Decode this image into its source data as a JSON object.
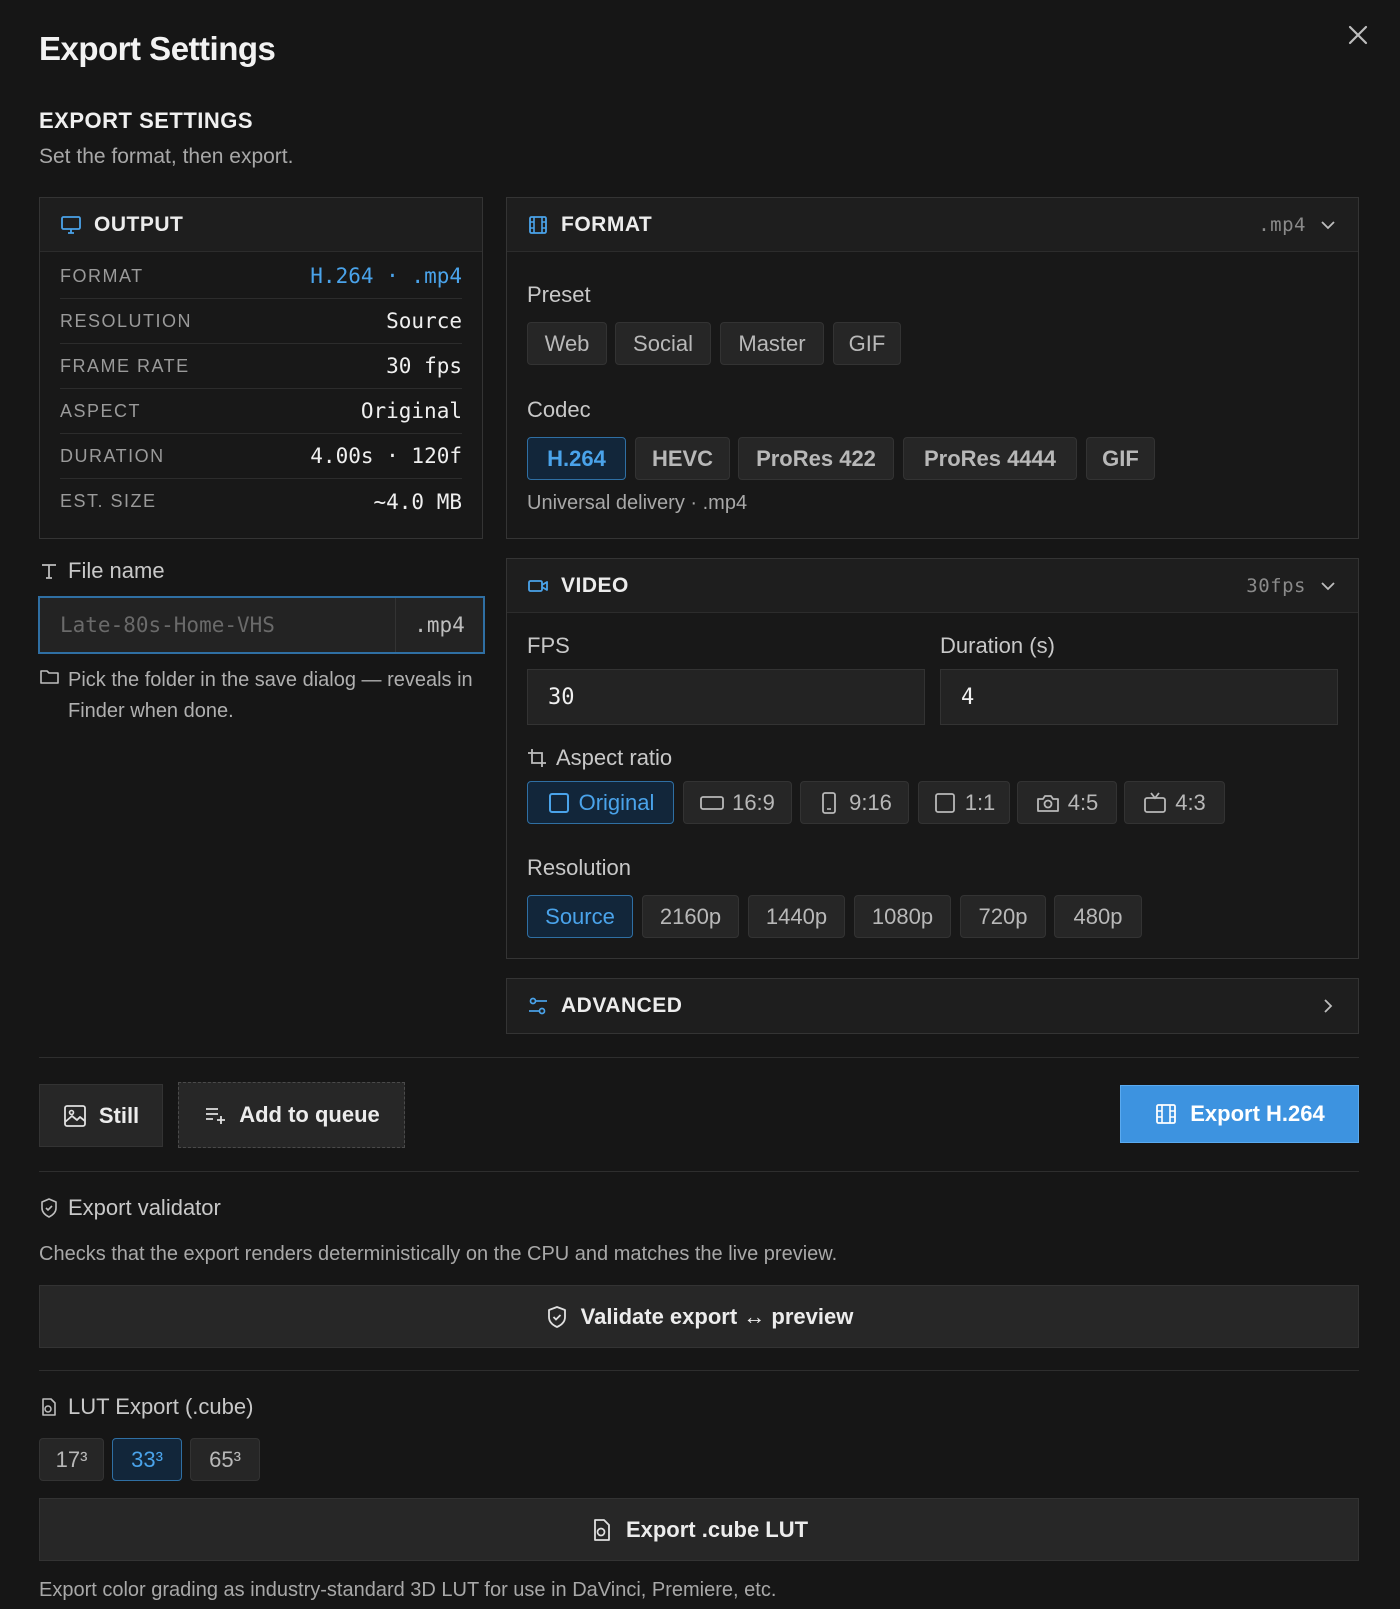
{
  "dialog": {
    "title": "Export Settings",
    "close_icon": "close-icon"
  },
  "section": {
    "title": "EXPORT SETTINGS",
    "subtitle": "Set the format, then export."
  },
  "output": {
    "title": "OUTPUT",
    "rows": [
      {
        "key": "FORMAT",
        "value": "H.264 · .mp4"
      },
      {
        "key": "RESOLUTION",
        "value": "Source"
      },
      {
        "key": "FRAME RATE",
        "value": "30 fps"
      },
      {
        "key": "ASPECT",
        "value": "Original"
      },
      {
        "key": "DURATION",
        "value": "4.00s · 120f"
      },
      {
        "key": "EST. SIZE",
        "value": "~4.0 MB"
      }
    ]
  },
  "file": {
    "label": "File name",
    "placeholder": "Late-80s-Home-VHS",
    "extension": ".mp4",
    "hint": "Pick the folder in the save dialog — reveals in Finder when done."
  },
  "format_panel": {
    "title": "FORMAT",
    "summary": ".mp4",
    "preset_label": "Preset",
    "presets": [
      "Web",
      "Social",
      "Master",
      "GIF"
    ],
    "codec_label": "Codec",
    "codecs": [
      "H.264",
      "HEVC",
      "ProRes 422",
      "ProRes 4444",
      "GIF"
    ],
    "selected_codec": "H.264",
    "codec_note": "Universal delivery · .mp4"
  },
  "video_panel": {
    "title": "VIDEO",
    "summary": "30fps",
    "fps_label": "FPS",
    "fps_value": "30",
    "duration_label": "Duration (s)",
    "duration_value": "4",
    "aspect_label": "Aspect ratio",
    "aspects": [
      "Original",
      "16:9",
      "9:16",
      "1:1",
      "4:5",
      "4:3"
    ],
    "selected_aspect": "Original",
    "resolution_label": "Resolution",
    "resolutions": [
      "Source",
      "2160p",
      "1440p",
      "1080p",
      "720p",
      "480p"
    ],
    "selected_resolution": "Source"
  },
  "advanced_panel": {
    "title": "ADVANCED"
  },
  "actions": {
    "still": "Still",
    "add_to_queue": "Add to queue",
    "export": "Export H.264"
  },
  "validator": {
    "title": "Export validator",
    "description": "Checks that the export renders deterministically on the CPU and matches the live preview.",
    "button": "Validate export ↔ preview"
  },
  "lut": {
    "title": "LUT Export (.cube)",
    "sizes": [
      "17³",
      "33³",
      "65³"
    ],
    "selected_size": "33³",
    "button": "Export .cube LUT",
    "note": "Export color grading as industry-standard 3D LUT for use in DaVinci, Premiere, etc."
  },
  "colors": {
    "accent": "#3d93e0",
    "accent_text": "#4aa3ea",
    "background": "#161616"
  }
}
